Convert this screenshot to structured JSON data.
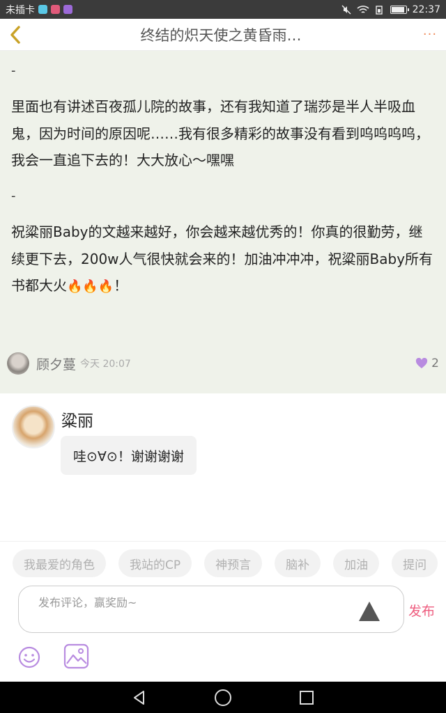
{
  "status_bar": {
    "carrier": "未插卡",
    "time": "22:37",
    "battery_level": 0.9
  },
  "header": {
    "title": "终结的炽天使之黄昏雨…",
    "more": "···"
  },
  "comment": {
    "dash_1": "-",
    "paragraph_1": "里面也有讲述百夜孤儿院的故事，还有我知道了瑞莎是半人半吸血鬼，因为时间的原因呢……我有很多精彩的故事没有看到呜呜呜呜，我会一直追下去的！大大放心～嘿嘿",
    "dash_2": "-",
    "paragraph_2": "祝粱丽Baby的文越来越好，你会越来越优秀的！你真的很勤劳，继续更下去，200w人气很快就会来的！加油冲冲冲，祝粱丽Baby所有书都大火",
    "paragraph_2_end": "！",
    "author": "顾夕蔓",
    "time": "今天 20:07",
    "likes": "2"
  },
  "reply": {
    "author": "粱丽",
    "text": "哇⊙∀⊙！谢谢谢谢"
  },
  "composer": {
    "chips": [
      "我最爱的角色",
      "我站的CP",
      "神预言",
      "脑补",
      "加油",
      "提问"
    ],
    "placeholder": "发布评论，赢奖励~",
    "send_label": "发布"
  },
  "colors": {
    "accent": "#ee5d7f",
    "more": "#f08a5a",
    "back_arrow": "#c9a227",
    "comment_bg": "#eff2ea",
    "icon_purple": "#b88be0"
  }
}
